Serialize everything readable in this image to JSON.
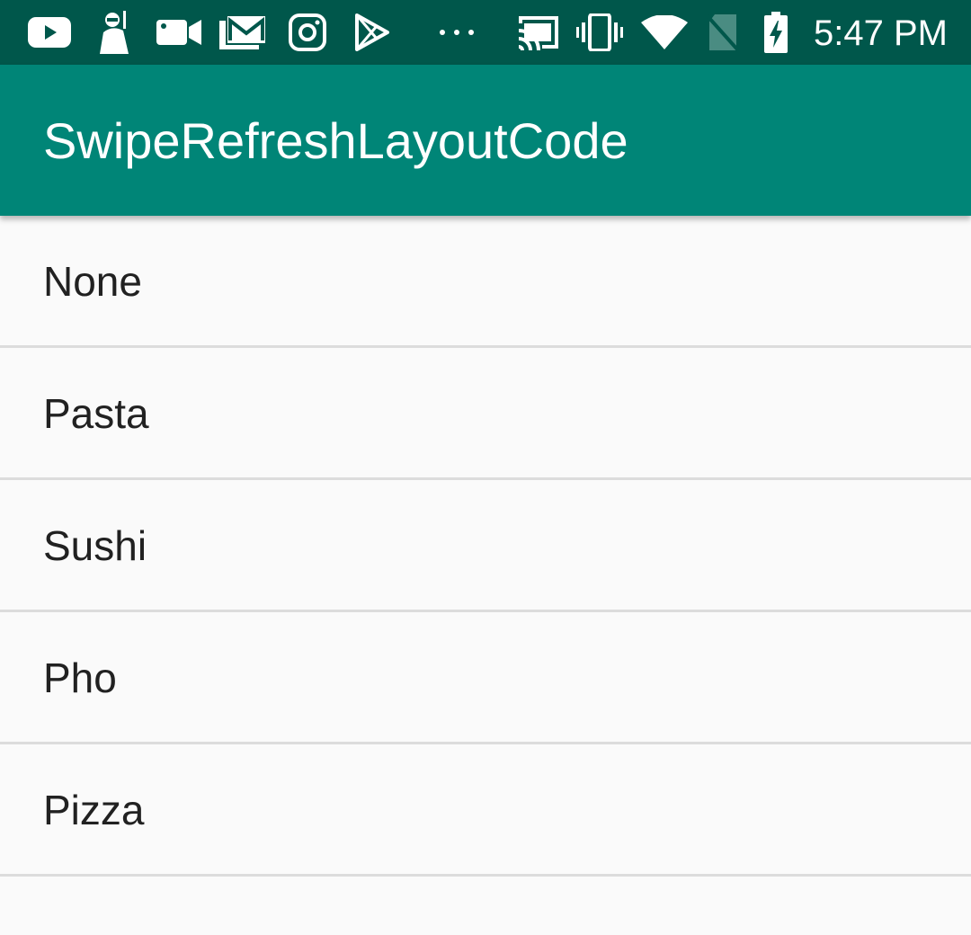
{
  "status_bar": {
    "time": "5:47 PM",
    "left_icons": [
      "youtube-icon",
      "pubg-icon",
      "video-camera-icon",
      "gmail-icon",
      "instagram-icon",
      "play-store-icon",
      "more-notifications-icon"
    ],
    "right_icons": [
      "cast-icon",
      "vibrate-icon",
      "wifi-icon",
      "no-sim-icon",
      "battery-charging-icon"
    ]
  },
  "app_bar": {
    "title": "SwipeRefreshLayoutCode",
    "color": "#008577"
  },
  "list": {
    "items": [
      {
        "label": "None"
      },
      {
        "label": "Pasta"
      },
      {
        "label": "Sushi"
      },
      {
        "label": "Pho"
      },
      {
        "label": "Pizza"
      }
    ]
  },
  "colors": {
    "status_bar": "#00574b",
    "app_bar": "#008577",
    "background": "#fafafa",
    "divider": "#dcdcdc",
    "text": "#212121"
  }
}
